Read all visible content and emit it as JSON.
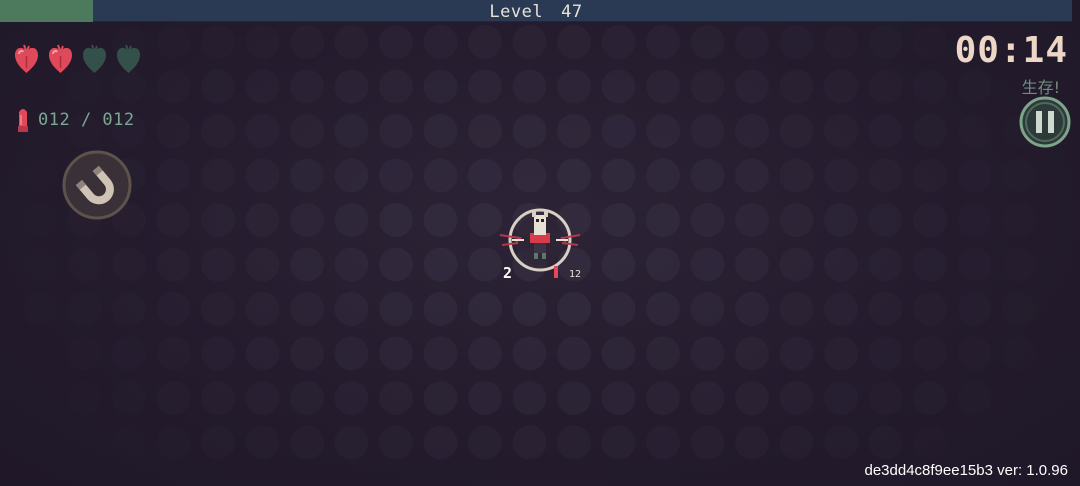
{
  "hud": {
    "level_label": "Level",
    "level_number": "47",
    "level_progress": 0.087,
    "hearts": {
      "total": 4,
      "filled": 2
    },
    "ammo": {
      "value": "012 / 012",
      "icon": "bullet-icon"
    },
    "magnet": {
      "icon": "magnet-icon"
    },
    "timer": "00:14",
    "objective": "生存!",
    "pause": {
      "icon": "pause-icon"
    }
  },
  "player": {
    "level_text": "2",
    "ammo_text": "12"
  },
  "footer": {
    "version": "de3dd4c8f9ee15b3 ver: 1.0.96"
  },
  "colors": {
    "heart_full": "#e0495a",
    "heart_empty": "#34504a",
    "level_fill": "#4d7a5c",
    "level_bar": "#2a3a55",
    "accent_text": "#7aa893",
    "timer_text": "#ecd7c6"
  }
}
